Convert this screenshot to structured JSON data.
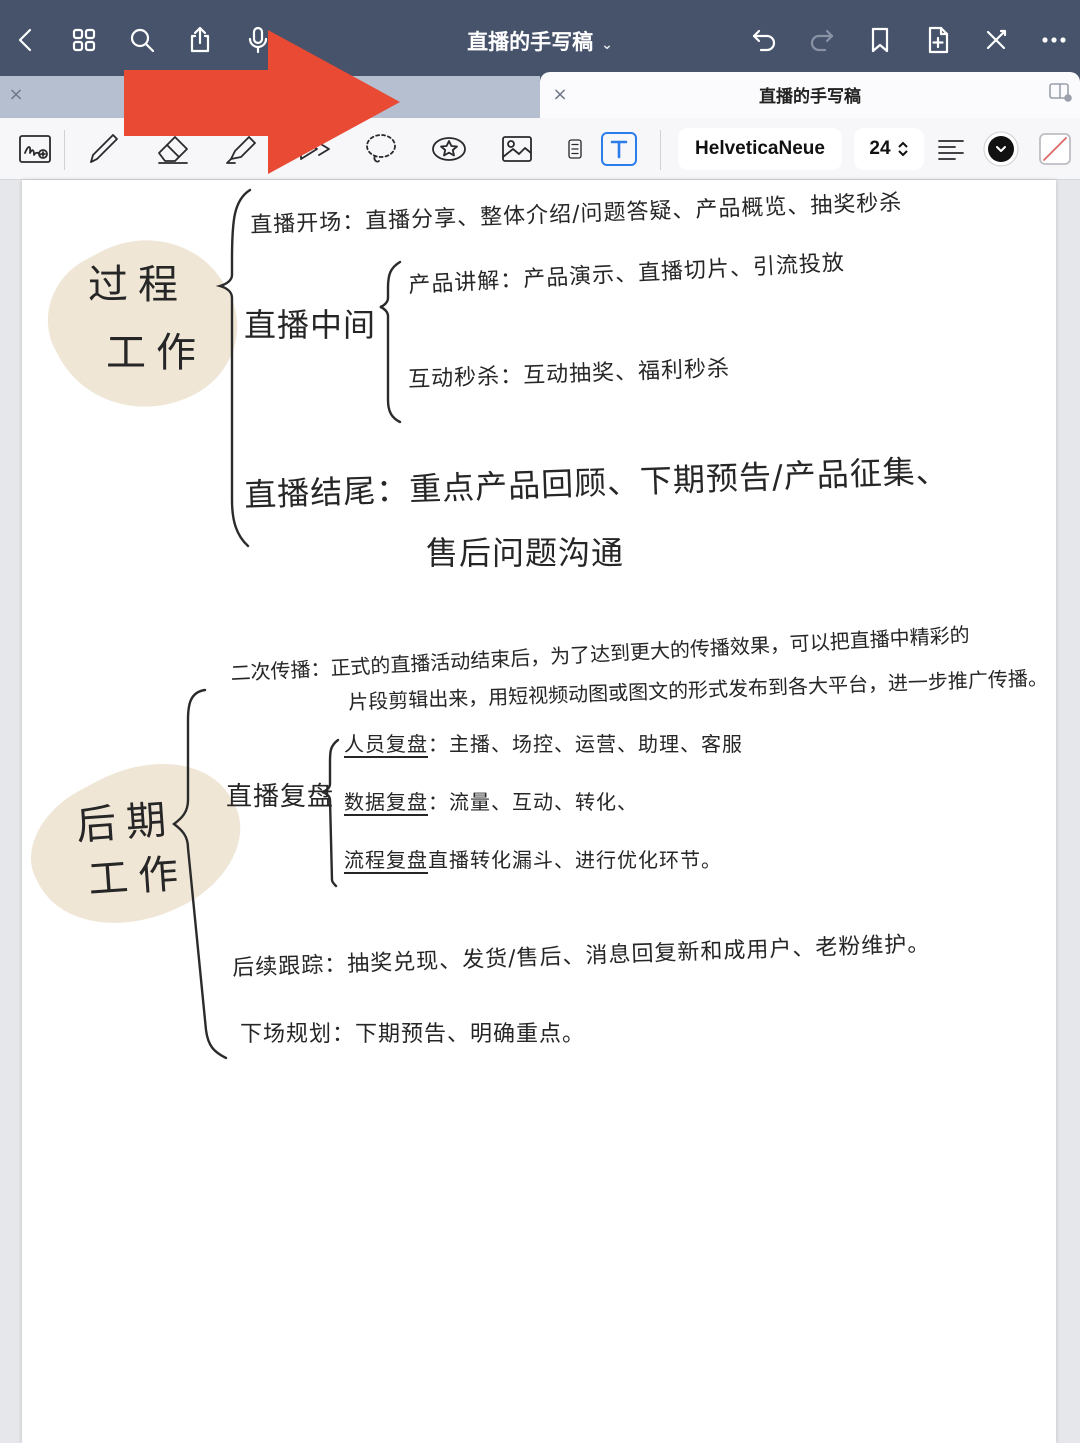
{
  "topbar": {
    "doc_title": "直播的手写稿",
    "title_chevron": "⌄"
  },
  "tabs": {
    "active_label": "直播的手写稿",
    "close_symbol": "×"
  },
  "toolbar": {
    "font_name": "HelveticaNeue",
    "font_size": "24",
    "stepper": "⌃⌄",
    "color_swatch": "#111111"
  },
  "annotation": {
    "arrow_color": "#e84a34"
  },
  "note": {
    "section1": {
      "label_line1": "过程",
      "label_line2": "工作",
      "opening": "直播开场：直播分享、整体介绍/问题答疑、产品概览、抽奖秒杀",
      "middle": "直播中间",
      "product": "产品讲解：产品演示、直播切片、引流投放",
      "interact": "互动秒杀：互动抽奖、福利秒杀",
      "ending": "直播结尾：重点产品回顾、下期预告/产品征集、",
      "ending2": "售后问题沟通"
    },
    "section2": {
      "label_line1": "后期",
      "label_line2": "工作",
      "secondary_line1": "二次传播：正式的直播活动结束后，为了达到更大的传播效果，可以把直播中精彩的",
      "secondary_line2": "片段剪辑出来，用短视频动图或图文的形式发布到各大平台，进一步推广传播。",
      "review": "直播复盘",
      "review_people_key": "人员复盘",
      "review_people_val": "：主播、场控、运营、助理、客服",
      "review_data_key": "数据复盘",
      "review_data_val": "：流量、互动、转化、",
      "review_flow_key": "流程复盘",
      "review_flow_val": "直播转化漏斗、进行优化环节。",
      "followup": "后续跟踪：抽奖兑现、发货/售后、消息回复新和成用户、老粉维护。",
      "nextplan": "下场规划：下期预告、明确重点。"
    }
  }
}
